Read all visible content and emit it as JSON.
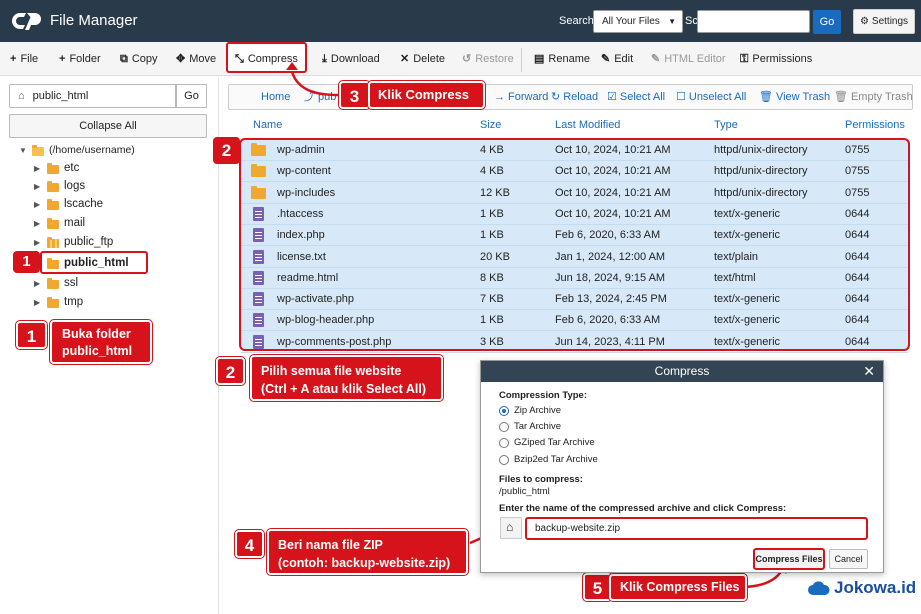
{
  "header": {
    "app_title": "File Manager",
    "search_label": "Search",
    "search_scope": "All Your Files",
    "for_label": "Sc",
    "search_value": "",
    "go_label": "Go",
    "settings_label": "Settings"
  },
  "toolbar": {
    "file": "File",
    "folder": "Folder",
    "copy": "Copy",
    "move": "Move",
    "compress": "Compress",
    "download": "Download",
    "delete": "Delete",
    "restore": "Restore",
    "rename": "Rename",
    "edit": "Edit",
    "html_editor": "HTML Editor",
    "permissions": "Permissions"
  },
  "sidebar": {
    "path_value": "public_html",
    "go_label": "Go",
    "collapse_all": "Collapse All",
    "root_label": "(/home/username)",
    "items": [
      {
        "label": "etc"
      },
      {
        "label": "logs"
      },
      {
        "label": "lscache"
      },
      {
        "label": "mail"
      },
      {
        "label": "public_ftp"
      },
      {
        "label": "public_html"
      },
      {
        "label": "ssl"
      },
      {
        "label": "tmp"
      }
    ]
  },
  "nav": {
    "home": "Home",
    "up": "pub",
    "forward": "Forward",
    "reload": "Reload",
    "select_all": "Select All",
    "unselect_all": "Unselect All",
    "view_trash": "View Trash",
    "empty_trash": "Empty Trash"
  },
  "table": {
    "columns": [
      "Name",
      "Size",
      "Last Modified",
      "Type",
      "Permissions"
    ],
    "rows": [
      {
        "name": "wp-admin",
        "size": "4 KB",
        "modified": "Oct 10, 2024, 10:21 AM",
        "type": "httpd/unix-directory",
        "perm": "0755",
        "kind": "folder"
      },
      {
        "name": "wp-content",
        "size": "4 KB",
        "modified": "Oct 10, 2024, 10:21 AM",
        "type": "httpd/unix-directory",
        "perm": "0755",
        "kind": "folder"
      },
      {
        "name": "wp-includes",
        "size": "12 KB",
        "modified": "Oct 10, 2024, 10:21 AM",
        "type": "httpd/unix-directory",
        "perm": "0755",
        "kind": "folder"
      },
      {
        "name": ".htaccess",
        "size": "1 KB",
        "modified": "Oct 10, 2024, 10:21 AM",
        "type": "text/x-generic",
        "perm": "0644",
        "kind": "file"
      },
      {
        "name": "index.php",
        "size": "1 KB",
        "modified": "Feb 6, 2020, 6:33 AM",
        "type": "text/x-generic",
        "perm": "0644",
        "kind": "file"
      },
      {
        "name": "license.txt",
        "size": "20 KB",
        "modified": "Jan 1, 2024, 12:00 AM",
        "type": "text/plain",
        "perm": "0644",
        "kind": "file"
      },
      {
        "name": "readme.html",
        "size": "8 KB",
        "modified": "Jun 18, 2024, 9:15 AM",
        "type": "text/html",
        "perm": "0644",
        "kind": "file"
      },
      {
        "name": "wp-activate.php",
        "size": "7 KB",
        "modified": "Feb 13, 2024, 2:45 PM",
        "type": "text/x-generic",
        "perm": "0644",
        "kind": "file"
      },
      {
        "name": "wp-blog-header.php",
        "size": "1 KB",
        "modified": "Feb 6, 2020, 6:33 AM",
        "type": "text/x-generic",
        "perm": "0644",
        "kind": "file"
      },
      {
        "name": "wp-comments-post.php",
        "size": "3 KB",
        "modified": "Jun 14, 2023, 4:11 PM",
        "type": "text/x-generic",
        "perm": "0644",
        "kind": "file"
      }
    ]
  },
  "callouts": {
    "step1_num": "1",
    "step1_text_a": "Buka folder",
    "step1_text_b": "public_html",
    "step2_num": "2",
    "step2_text_a": "Pilih  semua file  website",
    "step2_text_b": "(Ctrl + A atau klik Select All)",
    "step3_num": "3",
    "step3_text": "Klik  Compress",
    "step4_num": "4",
    "step4_text_a": "Beri nama file ZIP",
    "step4_text_b": "(contoh: backup-website.zip)",
    "step5_num": "5",
    "step5_text": "Klik Compress Files"
  },
  "dialog": {
    "title": "Compress",
    "close": "✕",
    "compression_type_label": "Compression Type:",
    "options": [
      "Zip Archive",
      "Tar Archive",
      "GZiped Tar Archive",
      "Bzip2ed Tar Archive"
    ],
    "selected_option": "Zip Archive",
    "files_label": "Files to compress:",
    "files_value": "/public_html",
    "name_prompt": "Enter the name of the compressed archive and click Compress:",
    "archive_name": "backup-website.zip",
    "compress_button": "Compress Files",
    "cancel_button": "Cancel"
  },
  "watermark": {
    "text": "Jokowa.id"
  },
  "colors": {
    "accent": "#d6121a",
    "link": "#1a6bbd",
    "header_bg": "#293a4a",
    "selected_row": "#d7e9f8"
  }
}
